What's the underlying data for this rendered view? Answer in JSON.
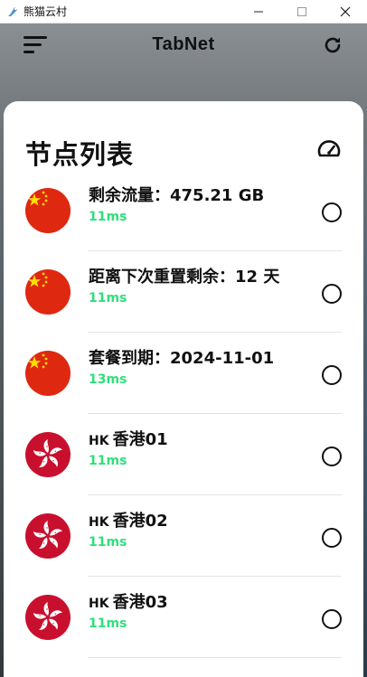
{
  "window": {
    "title": "熊猫云村",
    "controls": {
      "minimize": "—",
      "maximize": "☐",
      "close": "✕"
    }
  },
  "appbar": {
    "title": "TabNet",
    "menu_icon": "menu-icon",
    "refresh_icon": "refresh-icon"
  },
  "sheet": {
    "title": "节点列表",
    "speedtest_icon": "speedometer-icon"
  },
  "nodes": [
    {
      "flag": "cn",
      "prefix": "",
      "name": "剩余流量：475.21 GB",
      "latency": "11ms",
      "selected": false
    },
    {
      "flag": "cn",
      "prefix": "",
      "name": "距离下次重置剩余：12 天",
      "latency": "11ms",
      "selected": false
    },
    {
      "flag": "cn",
      "prefix": "",
      "name": "套餐到期：2024-11-01",
      "latency": "13ms",
      "selected": false
    },
    {
      "flag": "hk",
      "prefix": "HK",
      "name": "香港01",
      "latency": "11ms",
      "selected": false
    },
    {
      "flag": "hk",
      "prefix": "HK",
      "name": "香港02",
      "latency": "11ms",
      "selected": false
    },
    {
      "flag": "hk",
      "prefix": "HK",
      "name": "香港03",
      "latency": "11ms",
      "selected": false
    }
  ],
  "colors": {
    "latency": "#2fdf7b",
    "cn_flag_red": "#de2910",
    "cn_flag_star": "#ffde00",
    "hk_flag_red": "#c8102e"
  }
}
